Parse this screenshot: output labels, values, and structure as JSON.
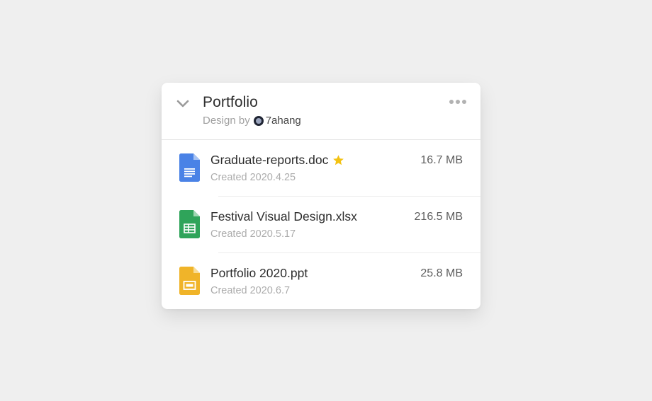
{
  "panel": {
    "title": "Portfolio",
    "subtitle_prefix": "Design by",
    "author": "7ahang",
    "collapse_icon": "chevron-down-icon",
    "menu_icon": "more-horizontal-icon"
  },
  "files": [
    {
      "name": "Graduate-reports.doc",
      "created": "Created 2020.4.25",
      "size": "16.7 MB",
      "starred": true,
      "icon": "doc-file-icon",
      "color": "#4a82e6"
    },
    {
      "name": "Festival Visual Design.xlsx",
      "created": "Created 2020.5.17",
      "size": "216.5 MB",
      "starred": false,
      "icon": "sheet-file-icon",
      "color": "#2fa45a"
    },
    {
      "name": "Portfolio 2020.ppt",
      "created": "Created 2020.6.7",
      "size": "25.8 MB",
      "starred": false,
      "icon": "slides-file-icon",
      "color": "#f0b429"
    }
  ],
  "colors": {
    "background": "#efefef",
    "card": "#ffffff",
    "star": "#f3c212"
  }
}
